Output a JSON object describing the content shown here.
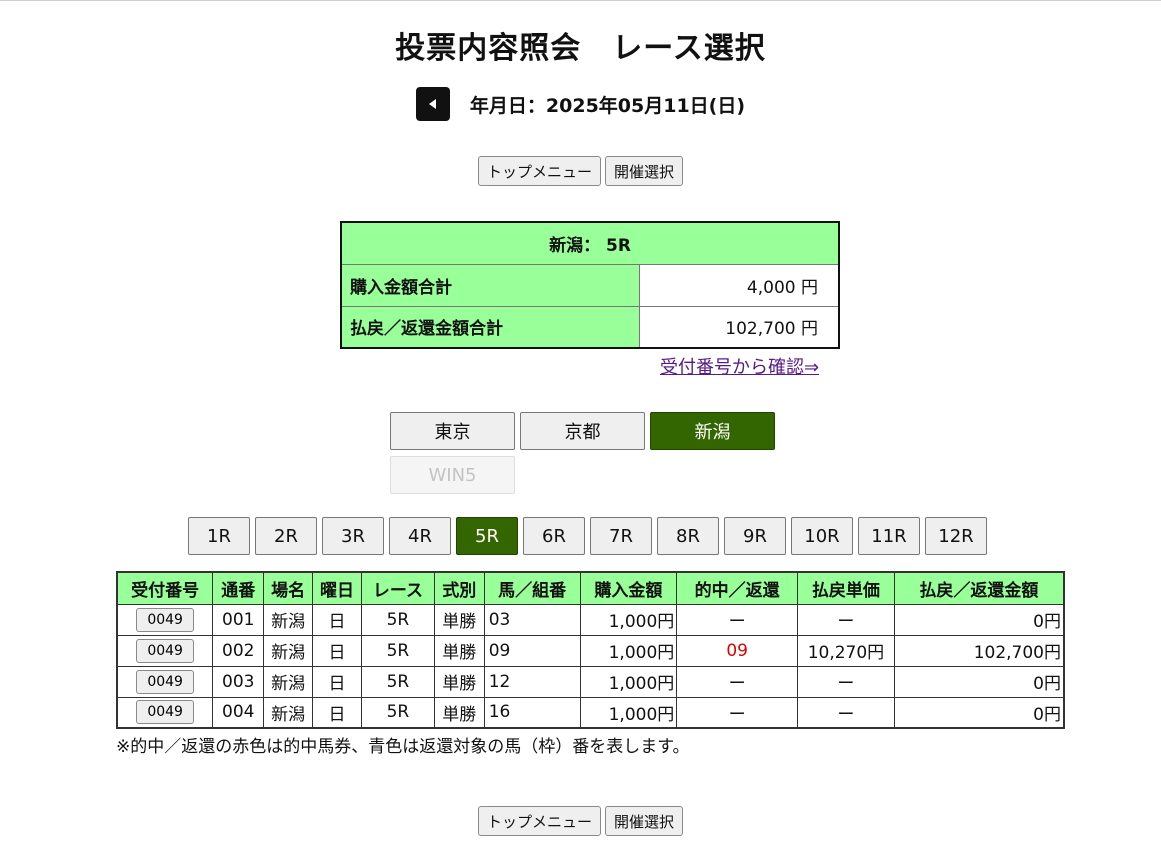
{
  "title": "投票内容照会　レース選択",
  "date": {
    "text": "年月日：2025年05月11日(日)"
  },
  "nav": {
    "top_menu": "トップメニュー",
    "venue_select": "開催選択"
  },
  "summary": {
    "heading": "新潟： 5R",
    "purchase_label": "購入金額合計",
    "purchase_value": "4,000 円",
    "refund_label": "払戻／返還金額合計",
    "refund_value": "102,700 円"
  },
  "confirm_link": "受付番号から確認⇒",
  "venues": [
    {
      "label": "東京",
      "active": false
    },
    {
      "label": "京都",
      "active": false
    },
    {
      "label": "新潟",
      "active": true
    }
  ],
  "win5": {
    "label": "WIN5",
    "disabled": true
  },
  "races": [
    "1R",
    "2R",
    "3R",
    "4R",
    "5R",
    "6R",
    "7R",
    "8R",
    "9R",
    "10R",
    "11R",
    "12R"
  ],
  "active_race": "5R",
  "table": {
    "headers": [
      "受付番号",
      "通番",
      "場名",
      "曜日",
      "レース",
      "式別",
      "馬／組番",
      "購入金額",
      "的中／返還",
      "払戻単価",
      "払戻／返還金額"
    ],
    "rows": [
      {
        "receipt": "0049",
        "serial": "001",
        "venue": "新潟",
        "day": "日",
        "race": "5R",
        "type": "単勝",
        "number": "03",
        "amount": "1,000円",
        "hit": "ー",
        "unit": "ー",
        "payout": "0円"
      },
      {
        "receipt": "0049",
        "serial": "002",
        "venue": "新潟",
        "day": "日",
        "race": "5R",
        "type": "単勝",
        "number": "09",
        "amount": "1,000円",
        "hit": "09",
        "unit": "10,270円",
        "payout": "102,700円"
      },
      {
        "receipt": "0049",
        "serial": "003",
        "venue": "新潟",
        "day": "日",
        "race": "5R",
        "type": "単勝",
        "number": "12",
        "amount": "1,000円",
        "hit": "ー",
        "unit": "ー",
        "payout": "0円"
      },
      {
        "receipt": "0049",
        "serial": "004",
        "venue": "新潟",
        "day": "日",
        "race": "5R",
        "type": "単勝",
        "number": "16",
        "amount": "1,000円",
        "hit": "ー",
        "unit": "ー",
        "payout": "0円"
      }
    ]
  },
  "note": "※的中／返還の赤色は的中馬券、青色は返還対象の馬（枠）番を表します。",
  "colors": {
    "header_green": "#99ff99",
    "active_green": "#336600",
    "hit_red": "#e00000",
    "link_purple": "#551a8b"
  },
  "icons": {
    "prev": "triangle-left-icon"
  }
}
